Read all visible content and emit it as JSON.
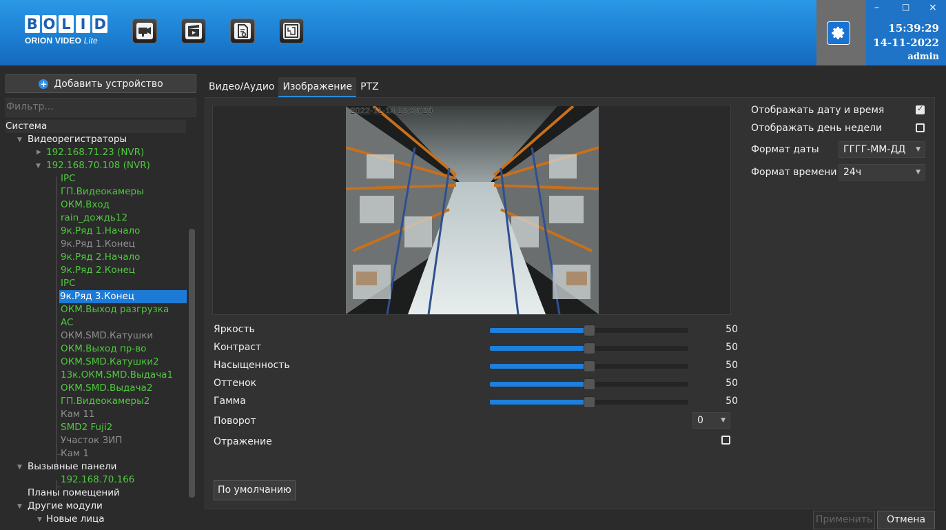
{
  "header": {
    "logo_top": "BOLID",
    "logo_bottom": "ORION VIDEO",
    "logo_lite": "Lite",
    "nav_icons": [
      "camera-icon",
      "video-clapper-icon",
      "report-icon",
      "map-plan-icon"
    ],
    "settings_icon": "gear-icon",
    "window_controls": {
      "minimize": "–",
      "maximize": "□",
      "close": "×"
    },
    "time": "15:39:29",
    "date": "14-11-2022",
    "user": "admin"
  },
  "sidebar": {
    "add_device_label": "Добавить устройство",
    "filter_placeholder": "Фильтр...",
    "tree": [
      {
        "label": "Система",
        "level": 0,
        "color": "white"
      },
      {
        "label": "Видеорегистраторы",
        "level": 1,
        "color": "white",
        "expanded": true
      },
      {
        "label": "192.168.71.23 (NVR)",
        "level": 2,
        "color": "green",
        "expanded": false
      },
      {
        "label": "192.168.70.108 (NVR)",
        "level": 2,
        "color": "green",
        "expanded": true
      },
      {
        "label": "IPC",
        "level": 3,
        "color": "green"
      },
      {
        "label": "ГП.Видеокамеры",
        "level": 3,
        "color": "green"
      },
      {
        "label": "ОКМ.Вход",
        "level": 3,
        "color": "green"
      },
      {
        "label": "rain_дождь12",
        "level": 3,
        "color": "green"
      },
      {
        "label": "9к.Ряд 1.Начало",
        "level": 3,
        "color": "green"
      },
      {
        "label": "9к.Ряд 1.Конец",
        "level": 3,
        "color": "gray"
      },
      {
        "label": "9к.Ряд 2.Начало",
        "level": 3,
        "color": "green"
      },
      {
        "label": "9к.Ряд 2.Конец",
        "level": 3,
        "color": "green"
      },
      {
        "label": "IPC",
        "level": 3,
        "color": "green"
      },
      {
        "label": "9к.Ряд 3.Конец",
        "level": 3,
        "color": "selected"
      },
      {
        "label": "ОКМ.Выход разгрузка",
        "level": 3,
        "color": "green"
      },
      {
        "label": "AC",
        "level": 3,
        "color": "green"
      },
      {
        "label": "ОКМ.SMD.Катушки",
        "level": 3,
        "color": "gray"
      },
      {
        "label": "ОКМ.Выход пр-во",
        "level": 3,
        "color": "green"
      },
      {
        "label": "ОКМ.SMD.Катушки2",
        "level": 3,
        "color": "green"
      },
      {
        "label": "13к.ОКМ.SMD.Выдача1",
        "level": 3,
        "color": "green"
      },
      {
        "label": "ОКМ.SMD.Выдача2",
        "level": 3,
        "color": "green"
      },
      {
        "label": "ГП.Видеокамеры2",
        "level": 3,
        "color": "green"
      },
      {
        "label": "Кам 11",
        "level": 3,
        "color": "gray"
      },
      {
        "label": "SMD2 Fuji2",
        "level": 3,
        "color": "green"
      },
      {
        "label": "Участок ЗИП",
        "level": 3,
        "color": "gray"
      },
      {
        "label": "Кам 1",
        "level": 3,
        "color": "gray"
      },
      {
        "label": "Вызывные панели",
        "level": 1,
        "color": "white",
        "expanded": true
      },
      {
        "label": "192.168.70.166",
        "level": 2,
        "color": "green"
      },
      {
        "label": "Планы помещений",
        "level": 1,
        "color": "white"
      },
      {
        "label": "Другие модули",
        "level": 1,
        "color": "white",
        "expanded": true
      },
      {
        "label": "Новые лица",
        "level": 2,
        "color": "white",
        "expanded": true
      }
    ]
  },
  "tabs": [
    {
      "label": "Видео/Аудио",
      "active": false
    },
    {
      "label": "Изображение",
      "active": true
    },
    {
      "label": "PTZ",
      "active": false
    }
  ],
  "video": {
    "timestamp": "2022-11-14 15:35:29"
  },
  "image_settings": {
    "sliders": [
      {
        "label": "Яркость",
        "value": 50,
        "min": 0,
        "max": 100
      },
      {
        "label": "Контраст",
        "value": 50,
        "min": 0,
        "max": 100
      },
      {
        "label": "Насыщенность",
        "value": 50,
        "min": 0,
        "max": 100
      },
      {
        "label": "Оттенок",
        "value": 50,
        "min": 0,
        "max": 100
      },
      {
        "label": "Гамма",
        "value": 50,
        "min": 0,
        "max": 100
      }
    ],
    "rotation_label": "Поворот",
    "rotation_value": "0",
    "mirror_label": "Отражение",
    "mirror_checked": false,
    "default_button": "По умолчанию"
  },
  "osd": {
    "show_datetime_label": "Отображать дату и время",
    "show_datetime_checked": true,
    "show_weekday_label": "Отображать день недели",
    "show_weekday_checked": false,
    "date_format_label": "Формат даты",
    "date_format_value": "ГГГГ-ММ-ДД",
    "time_format_label": "Формат времени",
    "time_format_value": "24ч"
  },
  "footer": {
    "apply_label": "Применить",
    "cancel_label": "Отмена"
  },
  "colors": {
    "accent": "#1e7fdc",
    "online_green": "#4ec93d",
    "offline_gray": "#8f8f8f",
    "header_blue": "#1d7fd2"
  }
}
